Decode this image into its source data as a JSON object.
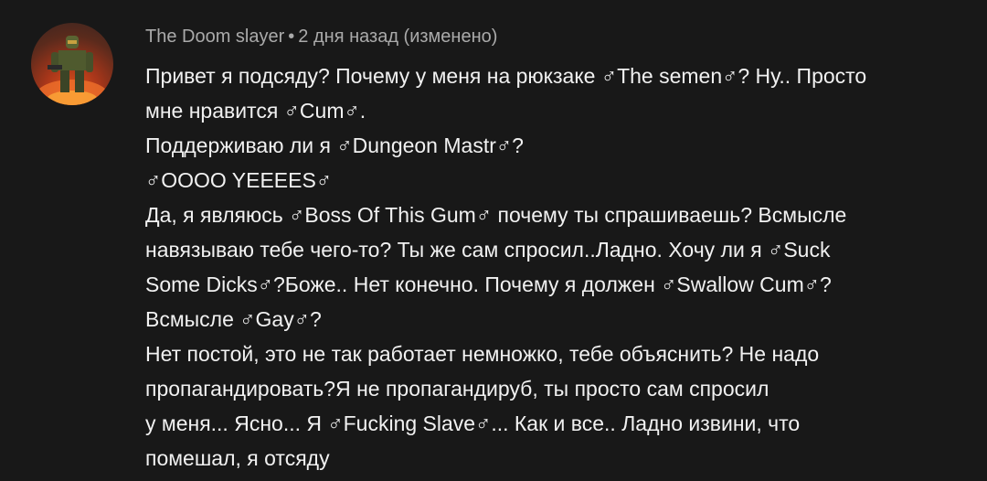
{
  "comment": {
    "author": "The Doom slayer",
    "separator": "•",
    "time": "2 дня назад (изменено)",
    "lines": [
      "Привет я подсяду? Почему у меня на рюкзаке ♂The semen♂? Ну.. Просто",
      "мне нравится ♂Cum♂.",
      "Поддерживаю ли я ♂Dungeon Mastr♂?",
      "♂OOOO YEEEES♂",
      "Да, я являюсь ♂Boss Of  This Gum♂ почему ты спрашиваешь? Всмысле",
      "навязываю тебе чего-то? Ты же сам спросил..Ладно. Хочу ли я ♂Suck",
      "Some Dicks♂?Боже.. Нет конечно. Почему я должен ♂Swallow Cum♂?",
      "Всмысле ♂Gay♂?",
      "Нет постой, это не так работает немножко, тебе объяснить? Не надо",
      "пропагандировать?Я не пропагандируб, ты просто сам спросил",
      "у меня... Ясно... Я ♂Fucking Slave♂... Как и все.. Ладно извини, что",
      "помешал, я отсяду"
    ]
  },
  "avatar": {
    "icon": "armored-soldier-avatar",
    "colors": {
      "fire": "#e2541a",
      "armor": "#4f5a2e"
    }
  }
}
